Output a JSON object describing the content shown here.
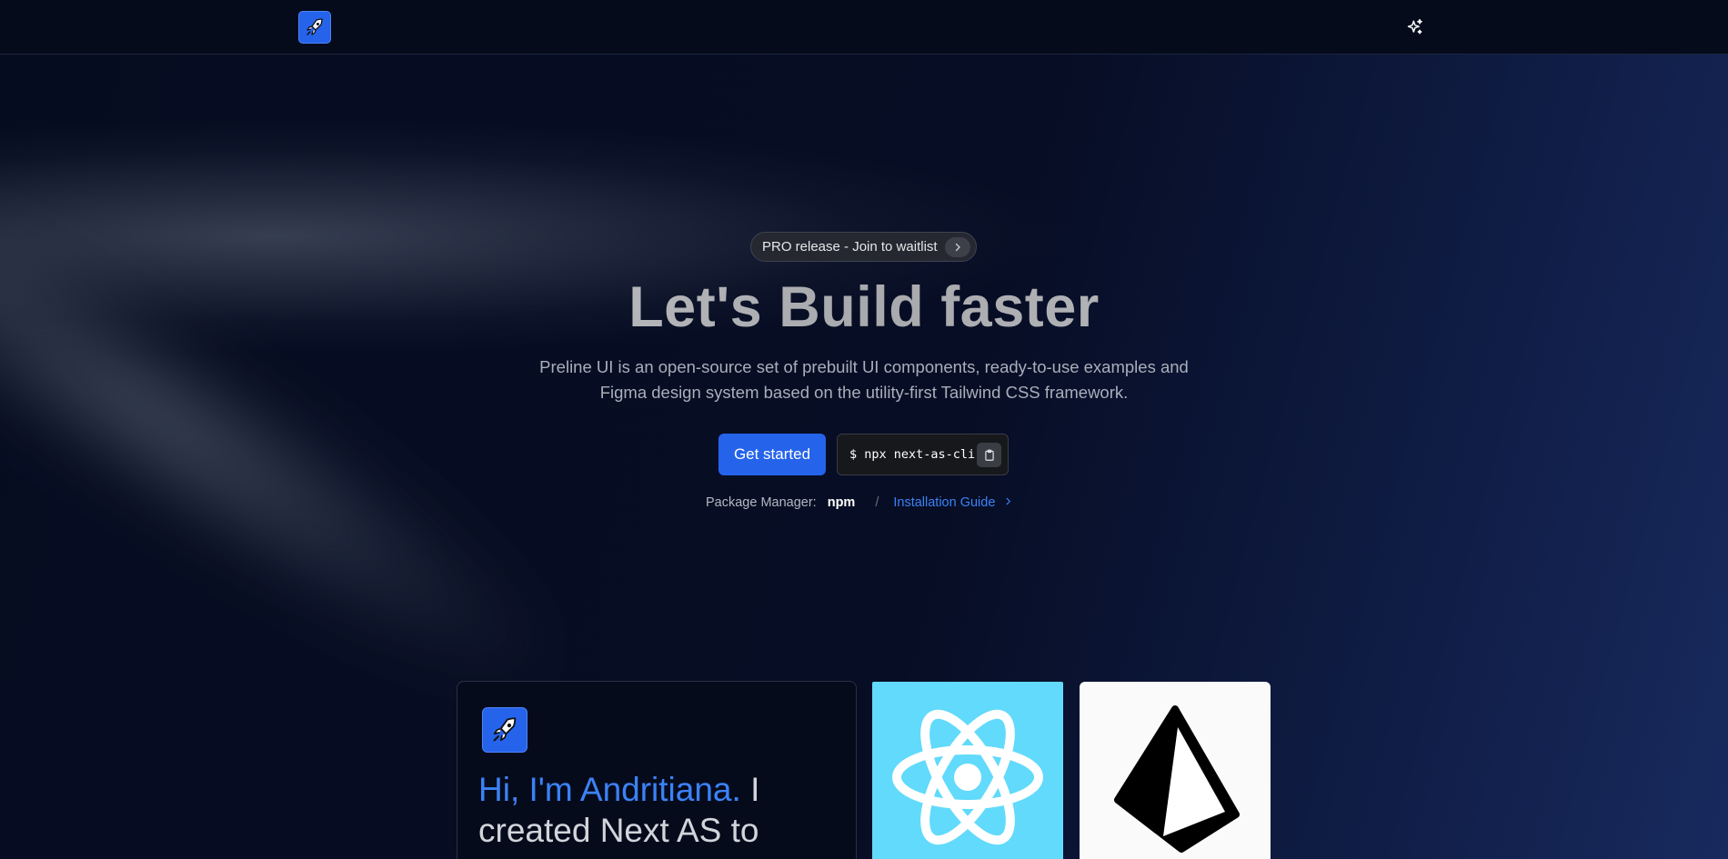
{
  "header": {
    "logo_icon": "rocket-icon",
    "theme_icon": "sparkles-icon"
  },
  "hero": {
    "announcement": "PRO release - Join to waitlist",
    "headline": "Let's Build faster",
    "subtitle_line1": "Preline UI is an open-source set of prebuilt UI components, ready-to-use examples and",
    "subtitle_line2": "Figma design system based on the utility-first Tailwind CSS framework.",
    "cta_label": "Get started",
    "cli_command": "$ npx next-as-cli",
    "package_manager_label": "Package Manager:",
    "package_manager_value": "npm",
    "separator": "/",
    "install_link": "Installation Guide"
  },
  "cards": {
    "intro_highlight": "Hi, I'm Andritiana.",
    "intro_rest": " I created Next AS to",
    "react_icon": "react-logo-icon",
    "prisma_icon": "prisma-logo-icon"
  },
  "colors": {
    "accent": "#2563eb",
    "link": "#3b82f6",
    "react_bg": "#61dafb",
    "background": "#050b1d"
  }
}
